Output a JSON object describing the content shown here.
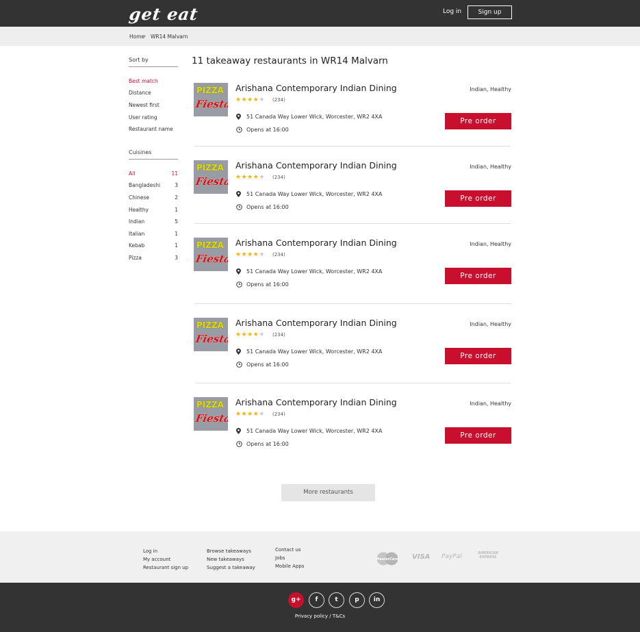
{
  "header": {
    "logo": "get eat",
    "login_label": "Log in",
    "signup_label": "Sign up"
  },
  "breadcrumb": {
    "items": [
      "Home",
      "WR14 Malvarn"
    ]
  },
  "sidebar": {
    "sort_title": "Sort by",
    "sort_options": [
      "Best match",
      "Distance",
      "Newest first",
      "User rating",
      "Restaurant name"
    ],
    "sort_selected": "Best match",
    "cuisines_title": "Cuisines",
    "cuisines": [
      {
        "label": "All",
        "count": "11"
      },
      {
        "label": "Bangladeshi",
        "count": "3"
      },
      {
        "label": "Chinese",
        "count": "2"
      },
      {
        "label": "Healthy",
        "count": "1"
      },
      {
        "label": "Indian",
        "count": "5"
      },
      {
        "label": "Italian",
        "count": "1"
      },
      {
        "label": "Kebab",
        "count": "1"
      },
      {
        "label": "Pizza",
        "count": "3"
      }
    ],
    "cuisine_selected": "All"
  },
  "results": {
    "heading": "11 takeaway restaurants in WR14 Malvarn",
    "restaurants": [
      {
        "logo_line1": "PIZZA",
        "logo_line2": "Fiesta",
        "name": "Arishana Contemporary Indian Dining",
        "rating": 4,
        "rating_max": 5,
        "reviews": "(234)",
        "cuisines": "Indian, Healthy",
        "address": "51 Canada Way Lower Wick, Worcester, WR2 4XA",
        "opens": "Opens at 16:00",
        "button": "Pre order"
      },
      {
        "logo_line1": "PIZZA",
        "logo_line2": "Fiesta",
        "name": "Arishana Contemporary Indian Dining",
        "rating": 4,
        "rating_max": 5,
        "reviews": "(234)",
        "cuisines": "Indian, Healthy",
        "address": "51 Canada Way Lower Wick, Worcester, WR2 4XA",
        "opens": "Opens at 16:00",
        "button": "Pre order"
      },
      {
        "logo_line1": "PIZZA",
        "logo_line2": "Fiesta",
        "name": "Arishana Contemporary Indian Dining",
        "rating": 4,
        "rating_max": 5,
        "reviews": "(234)",
        "cuisines": "Indian, Healthy",
        "address": "51 Canada Way Lower Wick, Worcester, WR2 4XA",
        "opens": "Opens at 16:00",
        "button": "Pre order"
      },
      {
        "logo_line1": "PIZZA",
        "logo_line2": "Fiesta",
        "name": "Arishana Contemporary Indian Dining",
        "rating": 4,
        "rating_max": 5,
        "reviews": "(234)",
        "cuisines": "Indian, Healthy",
        "address": "51 Canada Way Lower Wick, Worcester, WR2 4XA",
        "opens": "Opens at 16:00",
        "button": "Pre order"
      },
      {
        "logo_line1": "PIZZA",
        "logo_line2": "Fiesta",
        "name": "Arishana Contemporary Indian Dining",
        "rating": 4,
        "rating_max": 5,
        "reviews": "(234)",
        "cuisines": "Indian, Healthy",
        "address": "51 Canada Way Lower Wick, Worcester, WR2 4XA",
        "opens": "Opens at 16:00",
        "button": "Pre order"
      }
    ],
    "more_label": "More restaurants"
  },
  "footer": {
    "col1": [
      "Log in",
      "My account",
      "Restaurant sign up"
    ],
    "col2": [
      "Browse takeaways",
      "New takeaways",
      "Suggest a takeaway"
    ],
    "col3": [
      "Contact us",
      "Jobs",
      "Mobile Apps"
    ],
    "payments": [
      "MasterCard",
      "VISA",
      "PayPal",
      "AMERICAN EXPRESS"
    ],
    "social": [
      {
        "icon": "google-plus-icon",
        "glyph": "g+"
      },
      {
        "icon": "facebook-icon",
        "glyph": "f"
      },
      {
        "icon": "twitter-icon",
        "glyph": "t"
      },
      {
        "icon": "pinterest-icon",
        "glyph": "p"
      },
      {
        "icon": "linkedin-icon",
        "glyph": "in"
      }
    ],
    "privacy": "Privacy policy / T&Cs"
  },
  "colors": {
    "brand_red": "#c8102e",
    "header_bg": "#333333",
    "star": "#f5b400"
  }
}
